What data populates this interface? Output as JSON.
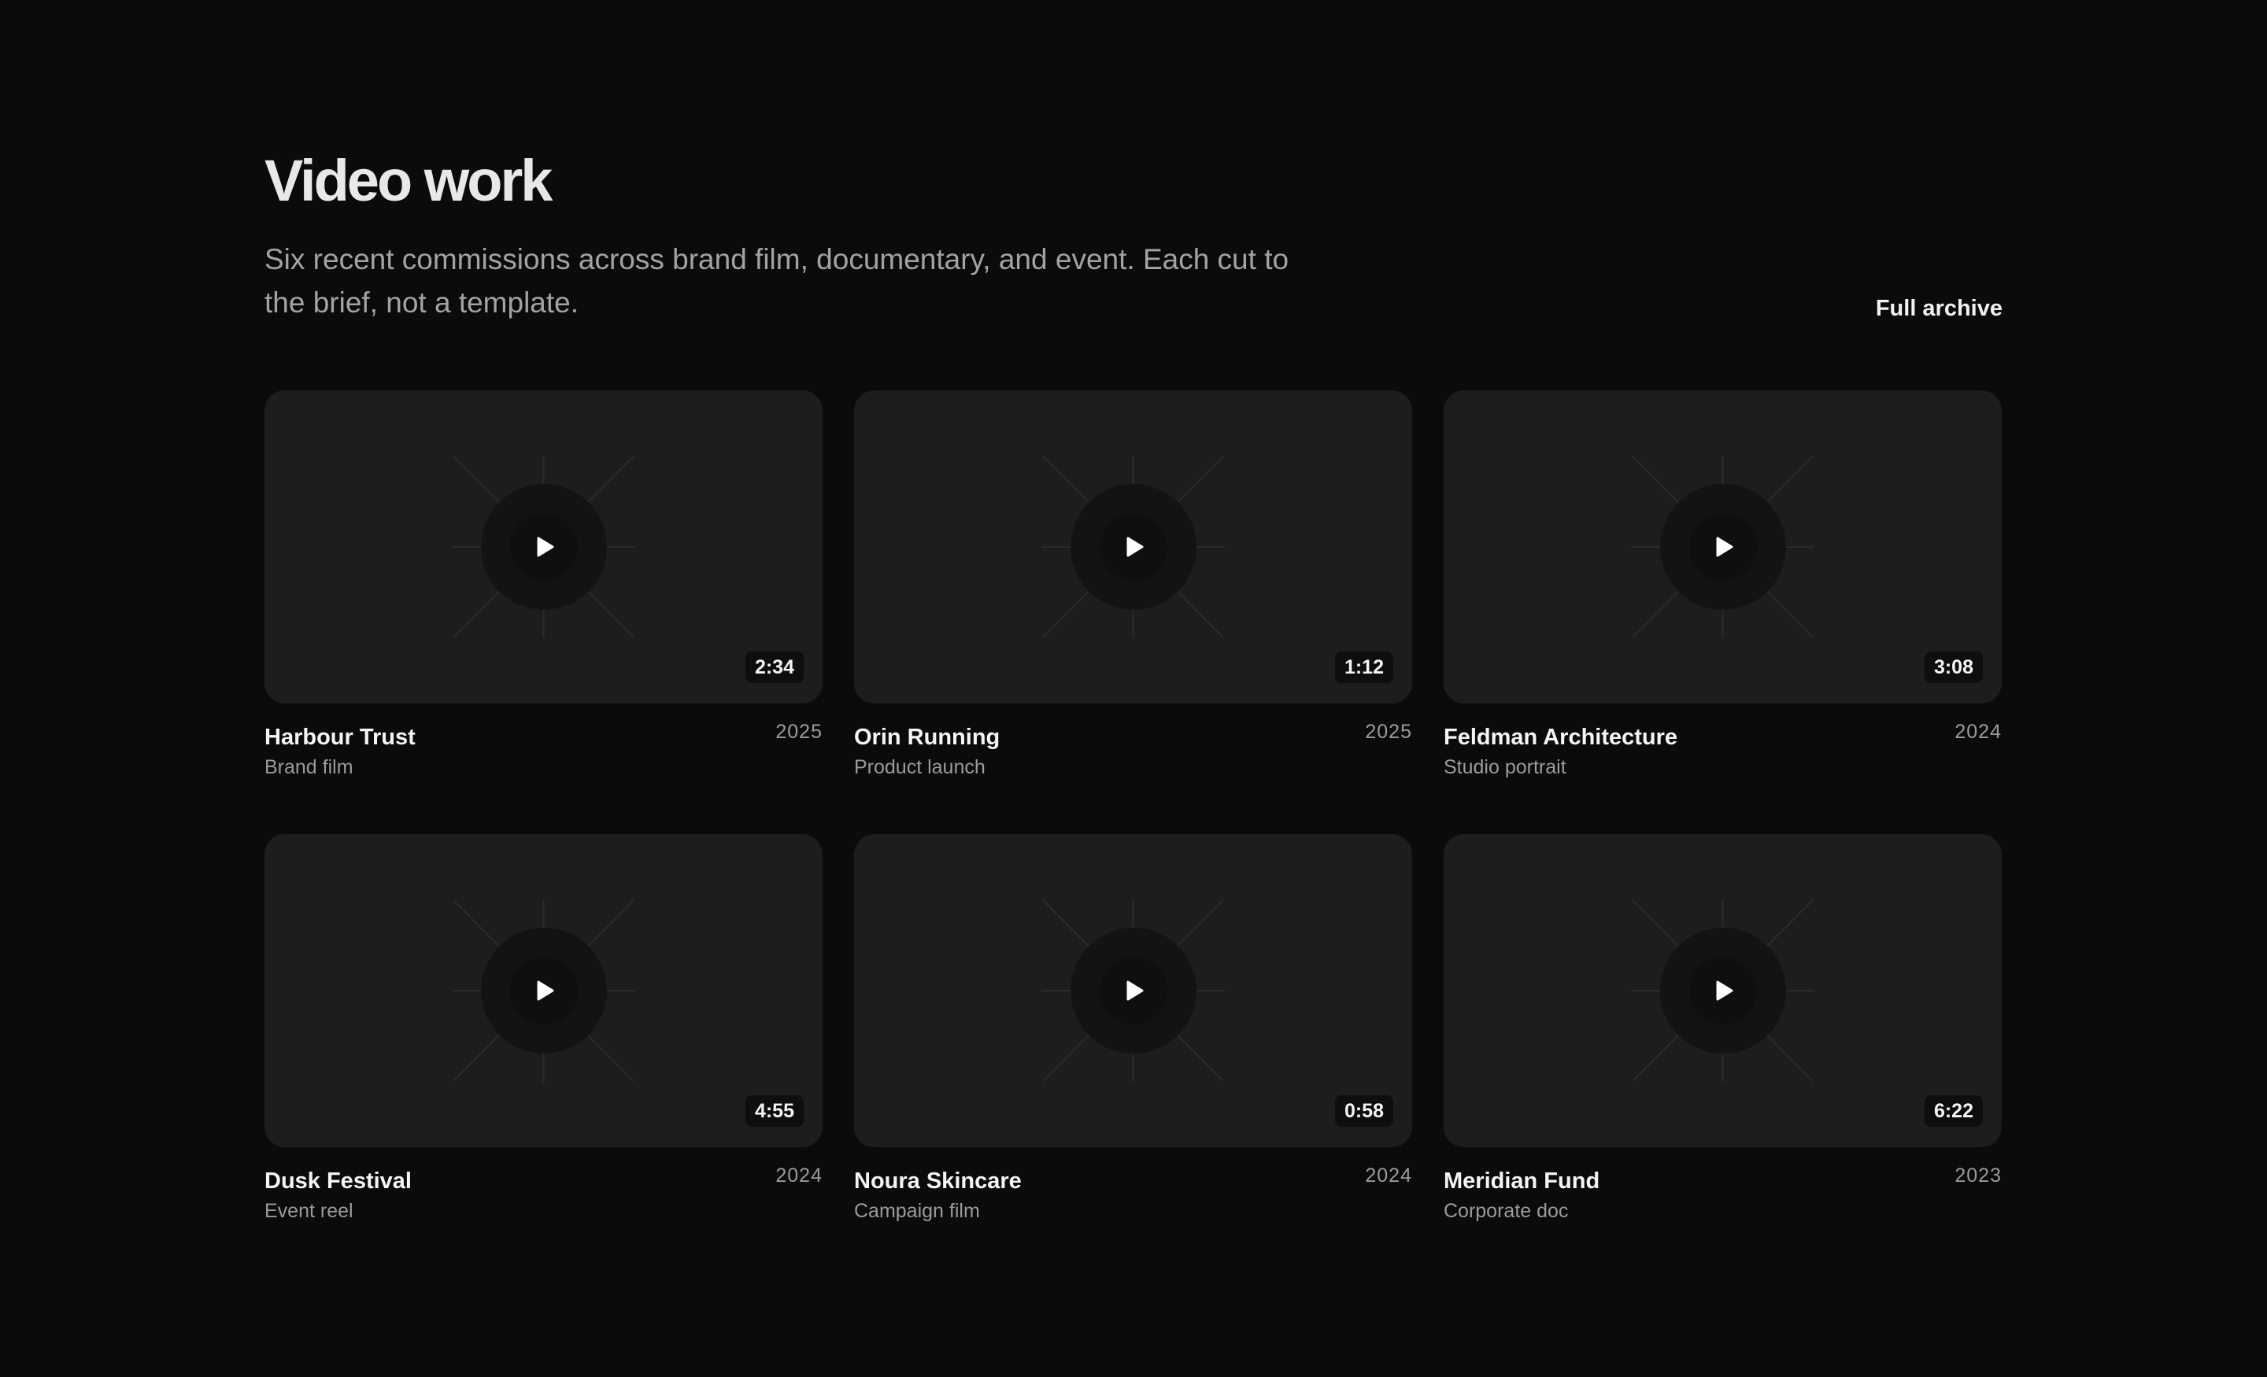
{
  "header": {
    "title": "Video work",
    "subtitle": "Six recent commissions across brand film, documentary, and event. Each cut to the brief, not a template.",
    "archive_link": "Full archive"
  },
  "colors": {
    "background": "#0b0b0b",
    "card": "#1d1d1d",
    "text_primary": "#f5f5f5",
    "text_muted": "#9b9b9b"
  },
  "videos": [
    {
      "client": "Harbour Trust",
      "kind": "Brand film",
      "year": "2025",
      "duration": "2:34"
    },
    {
      "client": "Orin Running",
      "kind": "Product launch",
      "year": "2025",
      "duration": "1:12"
    },
    {
      "client": "Feldman Architecture",
      "kind": "Studio portrait",
      "year": "2024",
      "duration": "3:08"
    },
    {
      "client": "Dusk Festival",
      "kind": "Event reel",
      "year": "2024",
      "duration": "4:55"
    },
    {
      "client": "Noura Skincare",
      "kind": "Campaign film",
      "year": "2024",
      "duration": "0:58"
    },
    {
      "client": "Meridian Fund",
      "kind": "Corporate doc",
      "year": "2023",
      "duration": "6:22"
    }
  ],
  "icons": {
    "play": "play-icon"
  }
}
